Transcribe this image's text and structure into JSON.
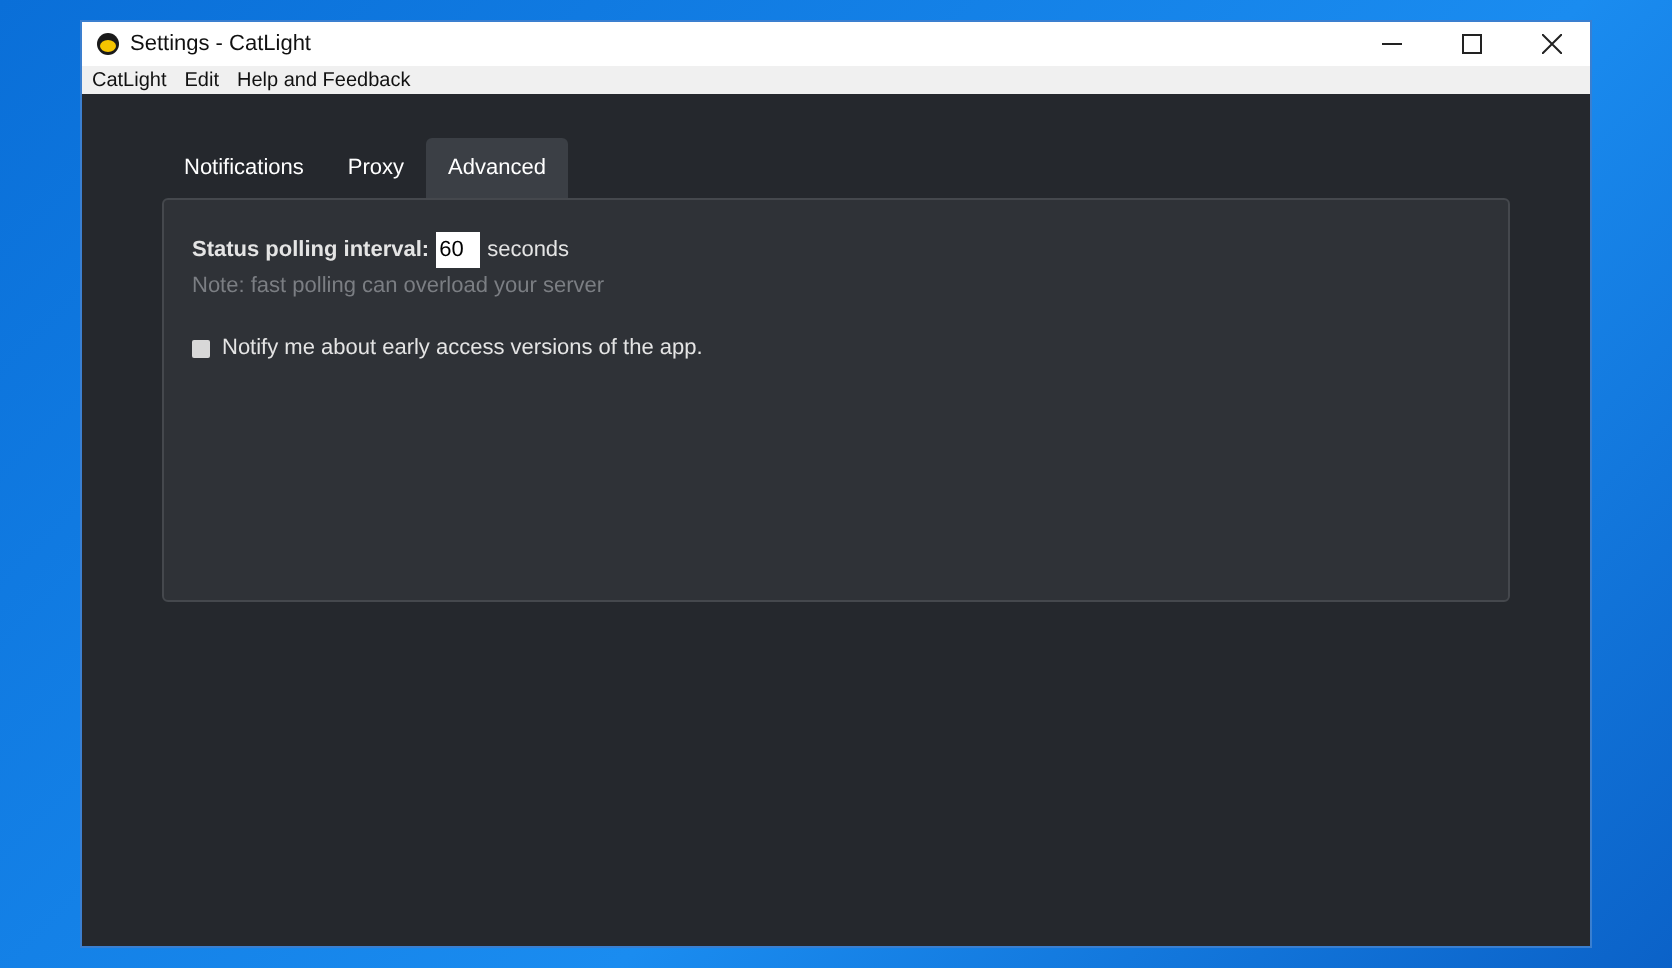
{
  "window": {
    "title": "Settings - CatLight"
  },
  "menu": [
    "CatLight",
    "Edit",
    "Help and Feedback"
  ],
  "tabs": [
    {
      "label": "Notifications",
      "selected": false
    },
    {
      "label": "Proxy",
      "selected": false
    },
    {
      "label": "Advanced",
      "selected": true
    }
  ],
  "polling": {
    "label": "Status polling interval:",
    "value": "60",
    "unit": "seconds",
    "note": "Note: fast polling can overload your server"
  },
  "early_access": {
    "label": "Notify me about early access versions of the app.",
    "checked": false
  }
}
